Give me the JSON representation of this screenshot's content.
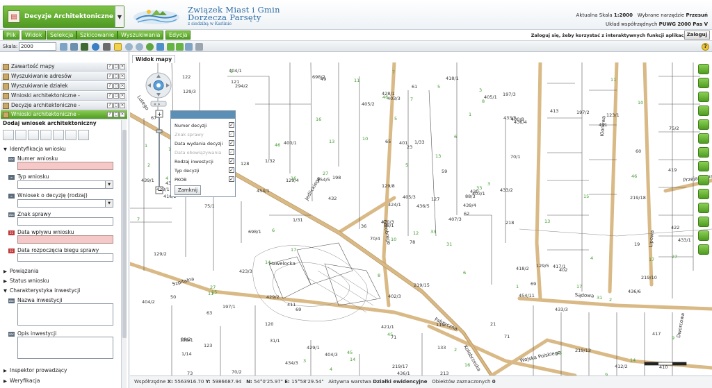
{
  "app": {
    "selected_app": "Decyzje Architektoniczne",
    "org_name_line1": "Związek Miast i Gmin",
    "org_name_line2": "Dorzecza Parsęty",
    "org_sub": "z siedzibą w Karlinie"
  },
  "header_info": {
    "scale_label": "Aktualna Skala",
    "scale_value": "1:2000",
    "tool_label": "Wybrane narzędzie",
    "tool_value": "Przesuń",
    "coords_label": "Układ współrzędnych",
    "coords_value": "PUWG 2000 Pas V"
  },
  "menu": [
    "Plik",
    "Widok",
    "Selekcja",
    "Szkicowanie",
    "Wyszukiwania",
    "Edycja"
  ],
  "login": {
    "note": "Zaloguj się, żeby korzystać z interaktywnych funkcji aplikacji",
    "button": "Zaloguj"
  },
  "toolbar": {
    "scale_label": "Skala:",
    "scale_value": "2000"
  },
  "panels": [
    "Zawartość mapy",
    "Wyszukiwanie adresów",
    "Wyszukiwanie działek",
    "Wnioski architektoniczne -",
    "Decyzje architektoniczne -",
    "Wnioski architektoniczne -"
  ],
  "form": {
    "title": "Dodaj wniosek architektoniczny",
    "section_identification": "Identyfikacja wniosku",
    "field_numer": "Numer wniosku",
    "field_typ": "Typ wniosku",
    "field_wniosek_o": "Wniosek o decyzję (rodzaj)",
    "field_znak": "Znak sprawy",
    "field_data_wplywu": "Data wpływu wniosku",
    "field_data_rozp": "Data rozpoczęcia biegu sprawy",
    "section_powiazania": "Powiązania",
    "section_status": "Status wniosku",
    "section_charakterystyka": "Charakterystyka inwestycji",
    "field_nazwa": "Nazwa inwestycji",
    "field_opis": "Opis inwestycji",
    "section_inspektor": "Inspektor prowadzący",
    "section_weryfikacja": "Weryfikacja"
  },
  "map": {
    "tab": "Widok mapy",
    "popup_rows": [
      {
        "label": "Numer decyzji",
        "checked": true,
        "disabled": false
      },
      {
        "label": "Znak sprawy",
        "checked": true,
        "disabled": true
      },
      {
        "label": "Data wydania decyzji",
        "checked": true,
        "disabled": false
      },
      {
        "label": "Data obowiązywania",
        "checked": true,
        "disabled": true
      },
      {
        "label": "Rodzaj inwestycji",
        "checked": true,
        "disabled": false
      },
      {
        "label": "Typ decyzji",
        "checked": true,
        "disabled": false
      },
      {
        "label": "PKOB",
        "checked": true,
        "disabled": false
      }
    ],
    "popup_close": "Zamknij",
    "street_labels": [
      "Szpitalna",
      "Jedlickiego",
      "Chrobrego",
      "Kołobrzeska",
      "Fabryczna",
      "Sądowa",
      "Wojska Polskiego",
      "Klonowa",
      "Lipowa",
      "Dworcowa",
      "Przejazdowa",
      "Hawelocka",
      "Lutego"
    ],
    "parcel_labels": [
      "78",
      "88/5",
      "88/1",
      "88/2",
      "88/3",
      "69",
      "197/3",
      "1/33",
      "400/8",
      "407/3",
      "294/2",
      "410",
      "75/1",
      "75/2",
      "70/4",
      "70/1",
      "70/2",
      "65",
      "59",
      "197/1",
      "198",
      "1/14",
      "31/1",
      "401",
      "403/1",
      "402",
      "403/2",
      "403/3",
      "416/2",
      "418/2",
      "419",
      "420/3",
      "421/1",
      "424/1",
      "400/1",
      "413",
      "411",
      "412/2",
      "417",
      "417/1",
      "418/1",
      "454/5",
      "454/1",
      "454/11",
      "434/3",
      "439/1",
      "439/4",
      "73",
      "71",
      "62",
      "63",
      "60",
      "67",
      "69",
      "71",
      "120",
      "121",
      "122",
      "119",
      "123/1",
      "61",
      "1/31",
      "1/10",
      "1/32",
      "197/2",
      "404/1",
      "405/1",
      "405/2",
      "405/3",
      "404/2",
      "402/3",
      "404/3",
      "129/5",
      "129/4",
      "129/1",
      "129/3",
      "128",
      "129/2",
      "129/8",
      "133",
      "127",
      "123",
      "218",
      "219/10",
      "219/17",
      "219/18",
      "219/15",
      "219/13",
      "213",
      "21",
      "428/1",
      "433/1",
      "433/2",
      "433/3",
      "436/5",
      "436/6",
      "436/2",
      "436/1",
      "433/5",
      "436/4",
      "698/1",
      "698/2",
      "422",
      "423/1",
      "423/3",
      "429/2",
      "429/1",
      "430",
      "431",
      "432",
      "19",
      "20",
      "23",
      "36",
      "49",
      "50"
    ],
    "green_labels": [
      "10",
      "11",
      "13",
      "14",
      "15",
      "16",
      "17",
      "27",
      "31",
      "33",
      "45",
      "46",
      "4",
      "5",
      "6",
      "7",
      "8",
      "9",
      "2",
      "3",
      "1",
      "12"
    ]
  },
  "status": {
    "coord_label": "Współrzędne",
    "x_label": "X:",
    "x_value": "5563916.70",
    "y_label": "Y:",
    "y_value": "5986687.94",
    "n_label": "N:",
    "n_value": "54°0'25.97\"",
    "e_label": "E:",
    "e_value": "15°58'29.54\"",
    "layer_label": "Aktywna warstwa",
    "layer_value": "Działki ewidencyjne",
    "selected_label": "Obiektów zaznaczonych",
    "selected_value": "0",
    "scale_text": "100 m"
  }
}
